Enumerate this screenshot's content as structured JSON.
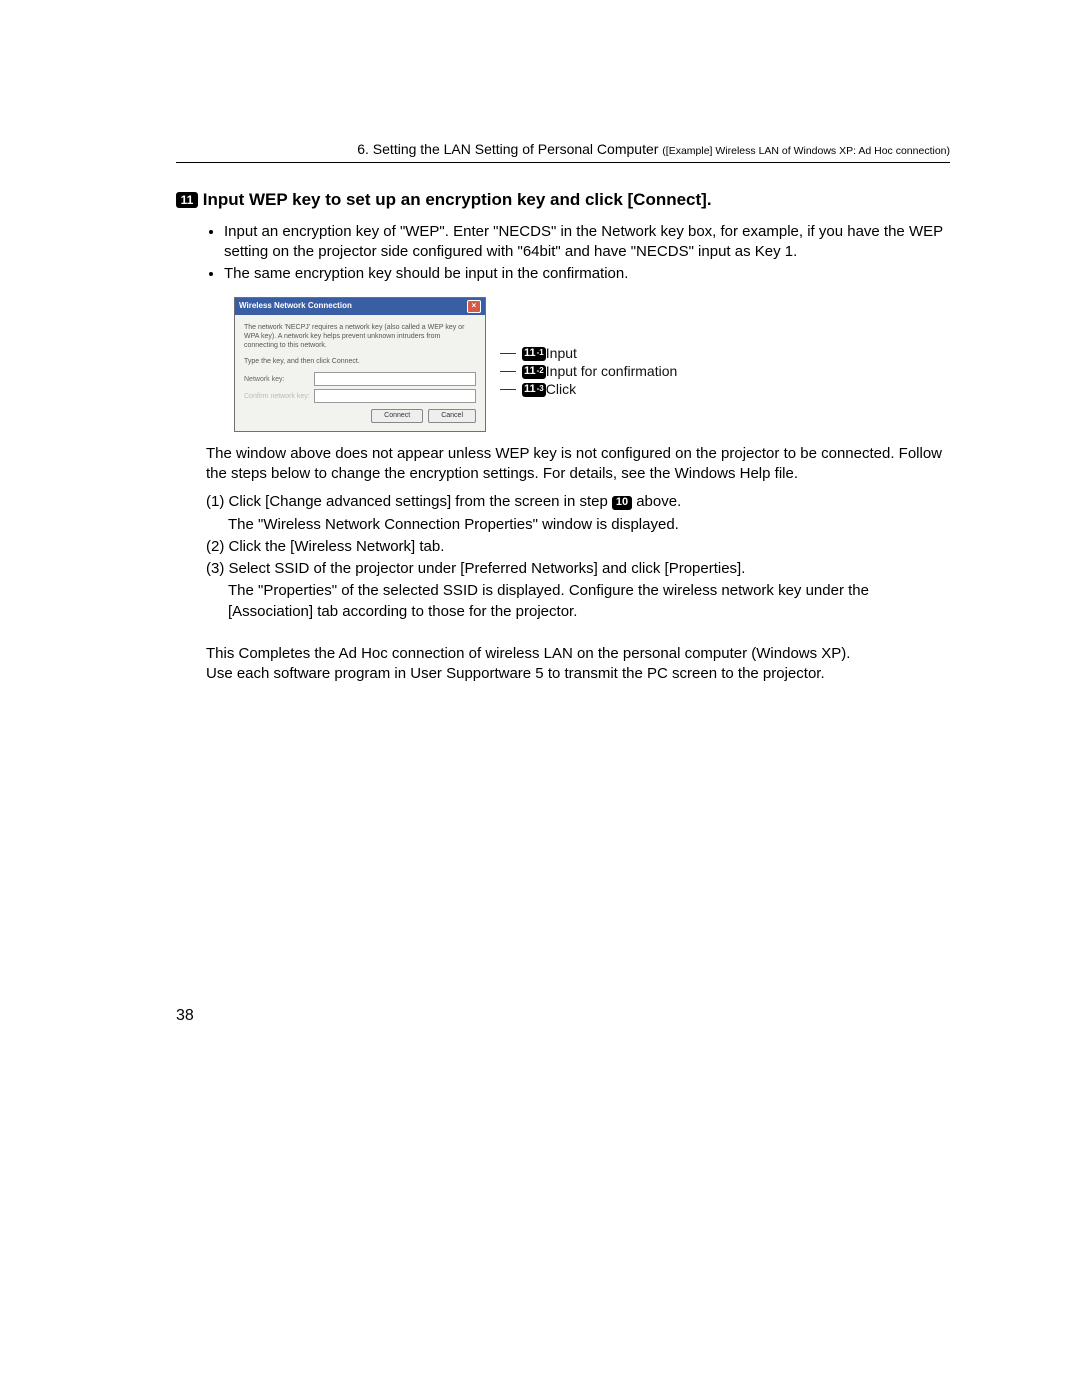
{
  "header": {
    "main": "6. Setting the LAN Setting of Personal Computer ",
    "sub": "([Example] Wireless LAN of Windows XP: Ad Hoc connection)"
  },
  "step_badge": "11",
  "section_title": " Input WEP key to set up an encryption key and click [Connect].",
  "bullets": [
    "Input an encryption key of \"WEP\". Enter \"NECDS\" in the Network key box, for example, if you have the WEP setting on the projector side configured with \"64bit\" and have \"NECDS\" input as Key 1.",
    "The same encryption key should be input in the confirmation."
  ],
  "dialog": {
    "title": "Wireless Network Connection",
    "desc": "The network 'NECPJ' requires a network key (also called a WEP key or WPA key). A network key helps prevent unknown intruders from connecting to this network.",
    "prompt": "Type the key, and then click Connect.",
    "label_key": "Network key:",
    "label_confirm": "Confirm network key:",
    "btn_connect": "Connect",
    "btn_cancel": "Cancel"
  },
  "callouts": {
    "c1_badge": "11",
    "c1_sub": "-1",
    "c1_text": " Input",
    "c2_badge": "11",
    "c2_sub": "-2",
    "c2_text": " Input for confirmation",
    "c3_badge": "11",
    "c3_sub": "-3",
    "c3_text": " Click"
  },
  "para1": "The window above does not appear unless WEP key is not configured on the projector to be connected. Follow the steps below to change the encryption settings.  For details, see the Windows Help file.",
  "steps": {
    "s1a": "(1) Click [Change advanced settings] from the screen in step ",
    "s1_badge": "10",
    "s1b": " above.",
    "s1_sub": "The \"Wireless Network Connection Properties\" window is displayed.",
    "s2": "(2) Click the [Wireless Network] tab.",
    "s3": "(3) Select SSID of the projector under [Preferred Networks] and click [Properties].",
    "s3_sub": "The \"Properties\" of the selected SSID is displayed.  Configure the wireless network key under the [Association] tab according to those for the projector."
  },
  "closing1": "This Completes the Ad Hoc connection of wireless LAN on the personal computer (Windows XP).",
  "closing2": "Use each software program in User Supportware 5 to transmit the PC screen to the projector.",
  "page_number": "38"
}
